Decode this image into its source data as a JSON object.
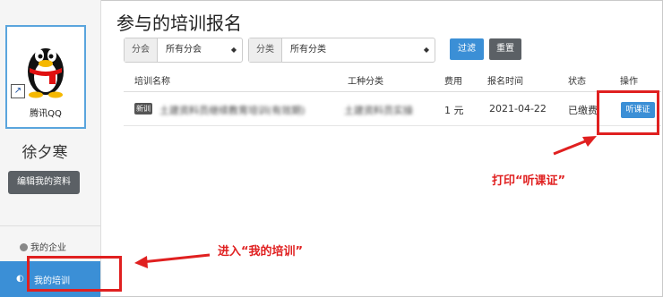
{
  "sidebar": {
    "avatar_label": "腾讯QQ",
    "username": "徐夕寒",
    "edit_button": "编辑我的资料",
    "nav": [
      {
        "label": "我的企业",
        "icon": "user-circle-icon"
      },
      {
        "label": "我的培训",
        "icon": "training-icon"
      }
    ]
  },
  "main": {
    "title": "参与的培训报名",
    "filters": {
      "branch": {
        "tag": "分会",
        "value": "所有分会"
      },
      "category": {
        "tag": "分类",
        "value": "所有分类"
      },
      "filter_button": "过滤",
      "reset_button": "重置"
    },
    "table": {
      "headers": [
        "培训名称",
        "工种分类",
        "费用",
        "报名时间",
        "状态",
        "操作"
      ],
      "rows": [
        {
          "badge": "新训",
          "name": "土建资料员继续教育培训(有效期)",
          "category": "土建资料员实操",
          "fee": "1 元",
          "date": "2021-04-22",
          "status": "已缴费",
          "action": "听课证"
        }
      ]
    }
  },
  "annotations": {
    "print_hint": "打印“听课证”",
    "enter_hint": "进入“我的培训”"
  },
  "colors": {
    "accent": "#3b8fd6",
    "annotation": "#e02020",
    "dark_button": "#5b6065"
  }
}
